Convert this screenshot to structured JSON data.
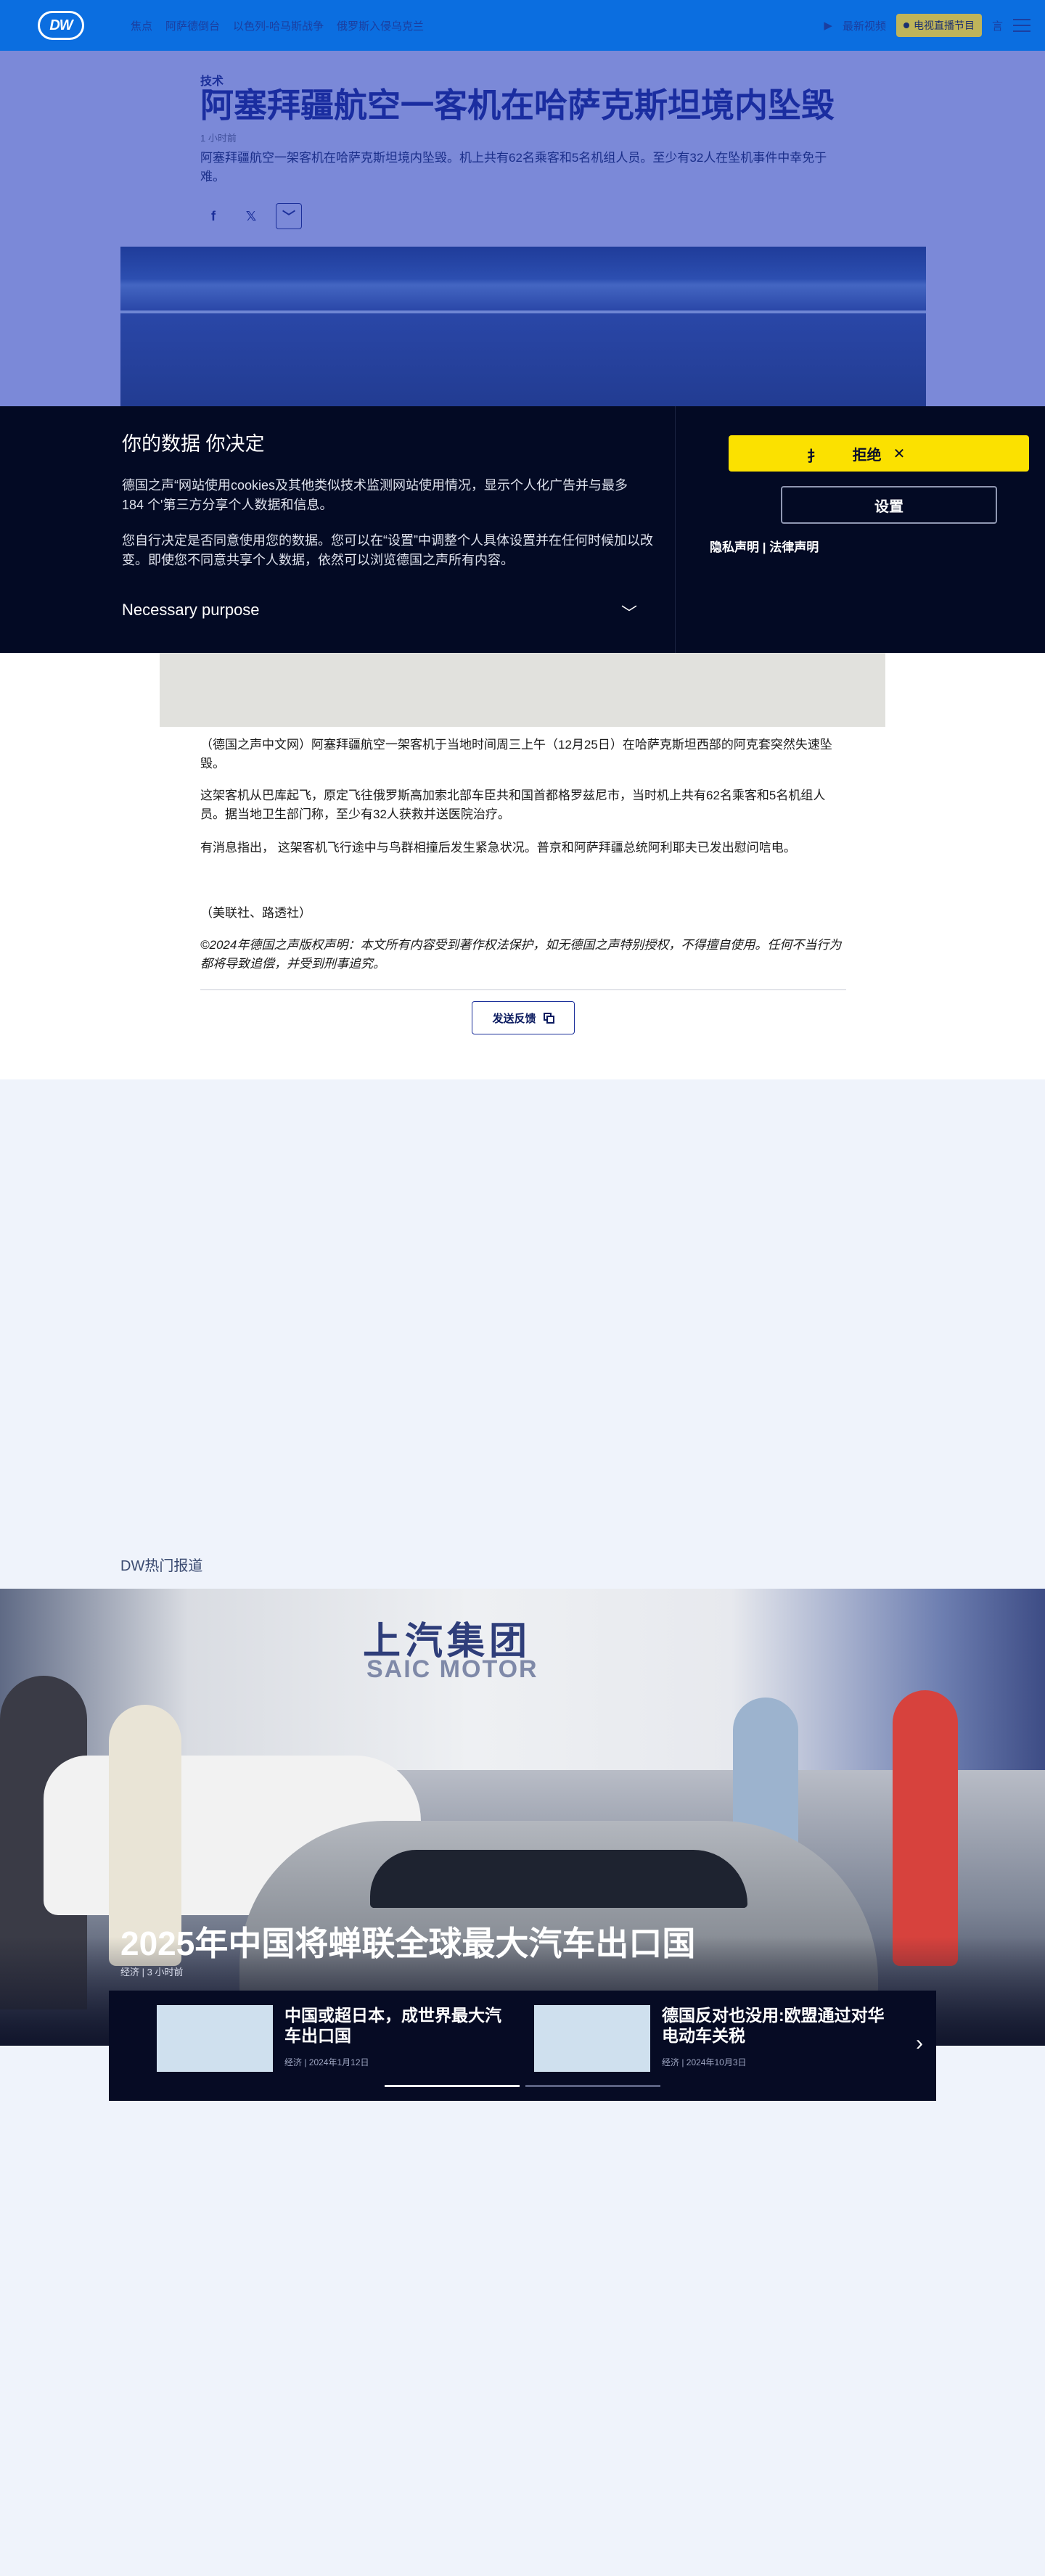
{
  "header": {
    "logo": "DW",
    "nav": [
      "焦点",
      "阿萨德倒台",
      "以色列-哈马斯战争",
      "俄罗斯入侵乌克兰"
    ],
    "latest": "最新视频",
    "live": "电视直播节目",
    "lang_icon": "language-icon"
  },
  "article": {
    "kicker": "技术",
    "title": "阿塞拜疆航空一客机在哈萨克斯坦境内坠毁",
    "time": "1 小时前",
    "lead": "阿塞拜疆航空一架客机在哈萨克斯坦境内坠毁。机上共有62名乘客和5名机组人员。至少有32人在坠机事件中幸免于难。",
    "paragraphs": [
      "（德国之声中文网）阿塞拜疆航空一架客机于当地时间周三上午（12月25日）在哈萨克斯坦西部的阿克套突然失速坠毁。",
      "这架客机从巴库起飞，原定飞往俄罗斯高加索北部车臣共和国首都格罗兹尼市，当时机上共有62名乘客和5名机组人员。据当地卫生部门称，至少有32人获救并送医院治疗。",
      "有消息指出， 这架客机飞行途中与鸟群相撞后发生紧急状况。普京和阿萨拜疆总统阿利耶夫已发出慰问唁电。",
      "（美联社、路透社）",
      "©2024年德国之声版权声明：本文所有内容受到著作权法保护，如无德国之声特别授权，不得擅自使用。任何不当行为都将导致追偿，并受到刑事追究。"
    ],
    "feedback": "发送反馈"
  },
  "cookie": {
    "title": "你的数据 你决定",
    "p1": "德国之声“网站使用cookies及其他类似技术监测网站使用情况，显示个人化广告并与最多184 个'第三方分享个人数据和信息。",
    "p2": "您自行决定是否同意使用您的数据。您可以在“设置”中调整个人具体设置并在任何时候加以改变。即使您不同意共享个人数据，依然可以浏览德国之声所有内容。",
    "purpose": "Necessary purpose",
    "reject_lead": "扌",
    "reject": "拒绝",
    "settings": "设置",
    "links": "隐私声明 | 法律声明"
  },
  "hot": {
    "label": "DW热门报道",
    "feature_title": "2025年中国将蝉联全球最大汽车出口国",
    "feature_meta": "经济 | 3 小时前",
    "image_brand_cn": "上汽集团",
    "image_brand_en": "SAIC MOTOR",
    "cards": [
      {
        "title": "中国或超日本，成世界最大汽车出口国",
        "meta": "经济 | 2024年1月12日"
      },
      {
        "title": "德国反对也没用:欧盟通过对华电动车关税",
        "meta": "经济 | 2024年10月3日"
      }
    ]
  }
}
